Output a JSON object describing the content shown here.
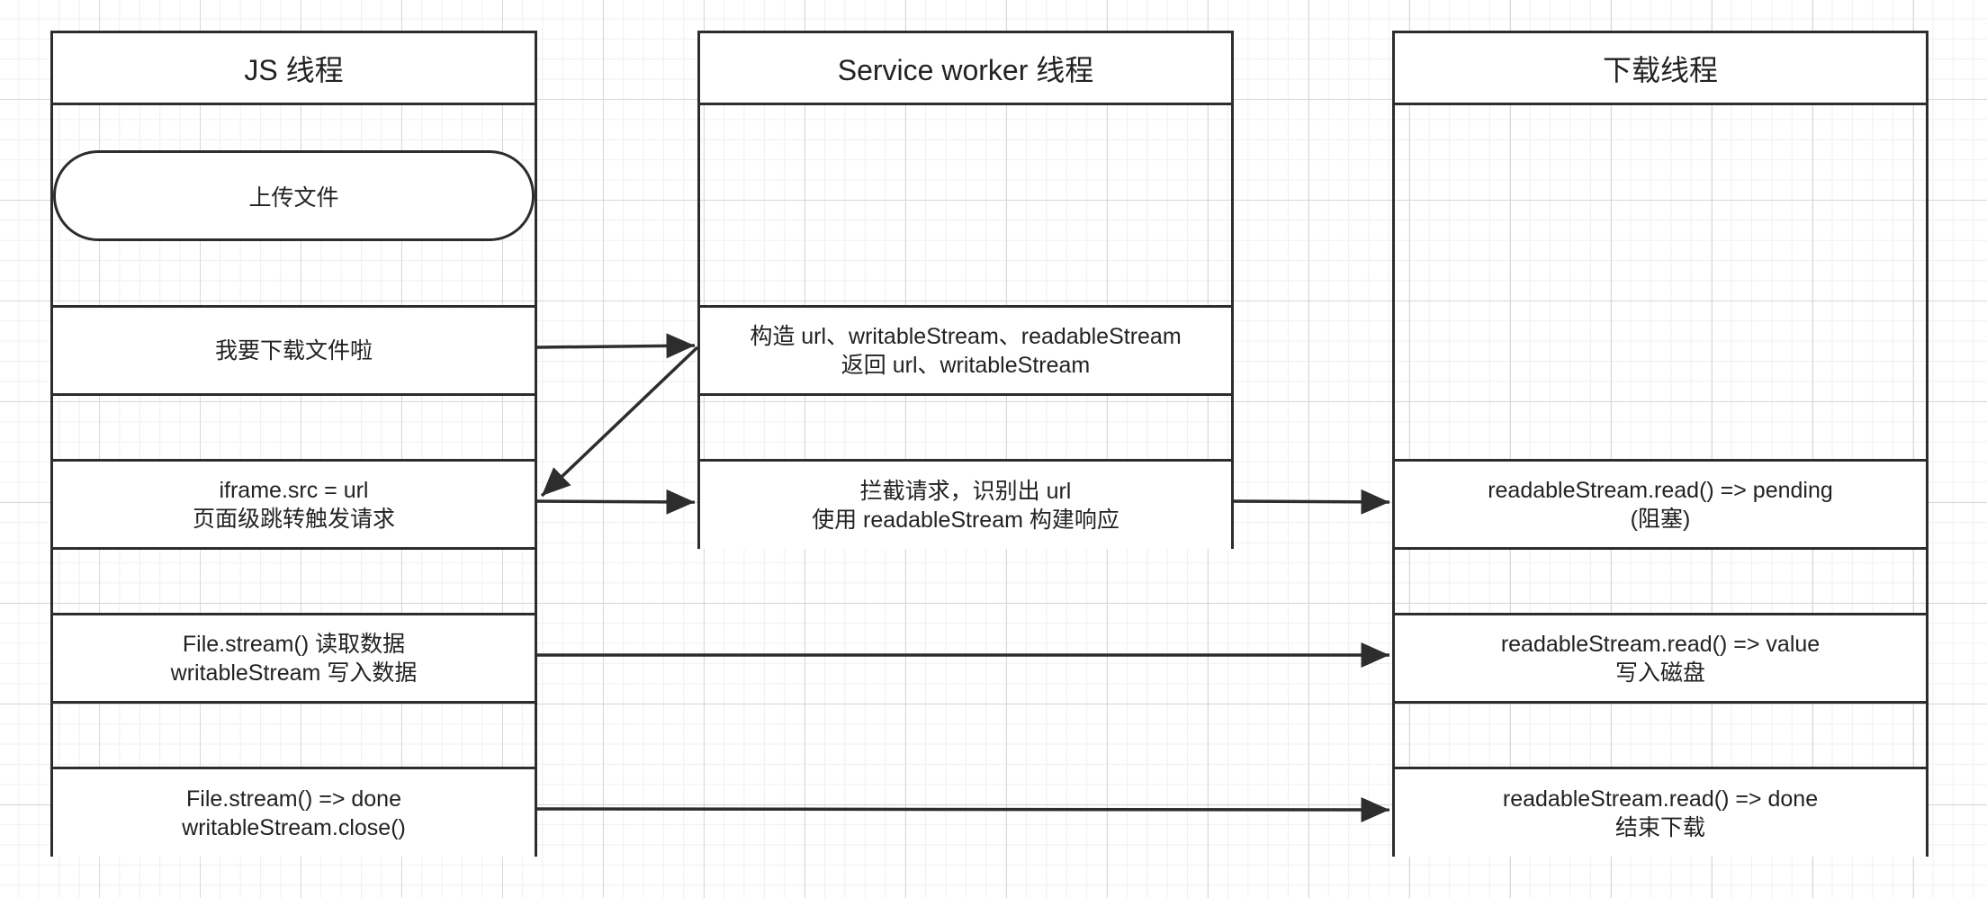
{
  "lanes": {
    "js": {
      "title": "JS 线程",
      "upload": "上传文件",
      "step1": "我要下载文件啦",
      "step2": [
        "iframe.src = url",
        "页面级跳转触发请求"
      ],
      "step3": [
        "File.stream() 读取数据",
        "writableStream 写入数据"
      ],
      "step4": [
        "File.stream() => done",
        "writableStream.close()"
      ]
    },
    "sw": {
      "title": "Service worker 线程",
      "step1": [
        "构造 url、writableStream、readableStream",
        "返回 url、writableStream"
      ],
      "step2": [
        "拦截请求，识别出 url",
        "使用 readableStream 构建响应"
      ]
    },
    "dl": {
      "title": "下载线程",
      "step2": [
        "readableStream.read() => pending",
        "(阻塞)"
      ],
      "step3": [
        "readableStream.read() => value",
        "写入磁盘"
      ],
      "step4": [
        "readableStream.read() => done",
        "结束下载"
      ]
    }
  },
  "colors": {
    "stroke": "#2d2d2d",
    "background": "#ffffff",
    "grid": "#d8d8d8"
  }
}
